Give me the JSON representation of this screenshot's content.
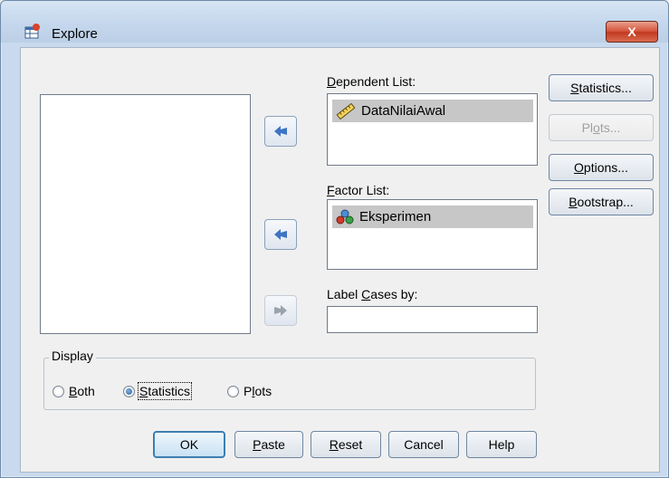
{
  "window": {
    "title": "Explore",
    "close_label": "X"
  },
  "dependent_list": {
    "label_prefix": "",
    "label_accel": "D",
    "label_rest": "ependent List:",
    "items": [
      "DataNilaiAwal"
    ]
  },
  "factor_list": {
    "label_accel": "F",
    "label_rest": "actor List:",
    "items": [
      "Eksperimen"
    ]
  },
  "label_cases": {
    "label_pre": "Label ",
    "label_accel": "C",
    "label_rest": "ases by:",
    "value": ""
  },
  "side_buttons": {
    "statistics": {
      "accel": "S",
      "rest": "tatistics..."
    },
    "plots": {
      "pre": "Pl",
      "accel": "o",
      "rest": "ts..."
    },
    "options": {
      "accel": "O",
      "rest": "ptions..."
    },
    "bootstrap": {
      "accel": "B",
      "rest": "ootstrap..."
    }
  },
  "display": {
    "title": "Display",
    "options": [
      {
        "accel": "B",
        "rest": "oth",
        "checked": false
      },
      {
        "accel": "S",
        "rest": "tatistics",
        "checked": true
      },
      {
        "pre": "P",
        "accel": "l",
        "rest": "ots",
        "checked": false
      }
    ]
  },
  "bottom_buttons": {
    "ok": "OK",
    "paste": {
      "accel": "P",
      "rest": "aste"
    },
    "reset": {
      "accel": "R",
      "rest": "eset"
    },
    "cancel": "Cancel",
    "help": "Help"
  },
  "colors": {
    "arrow_enabled": "#3d74c4",
    "arrow_disabled": "#9aa3ad",
    "selection": "#c7c7c7"
  }
}
